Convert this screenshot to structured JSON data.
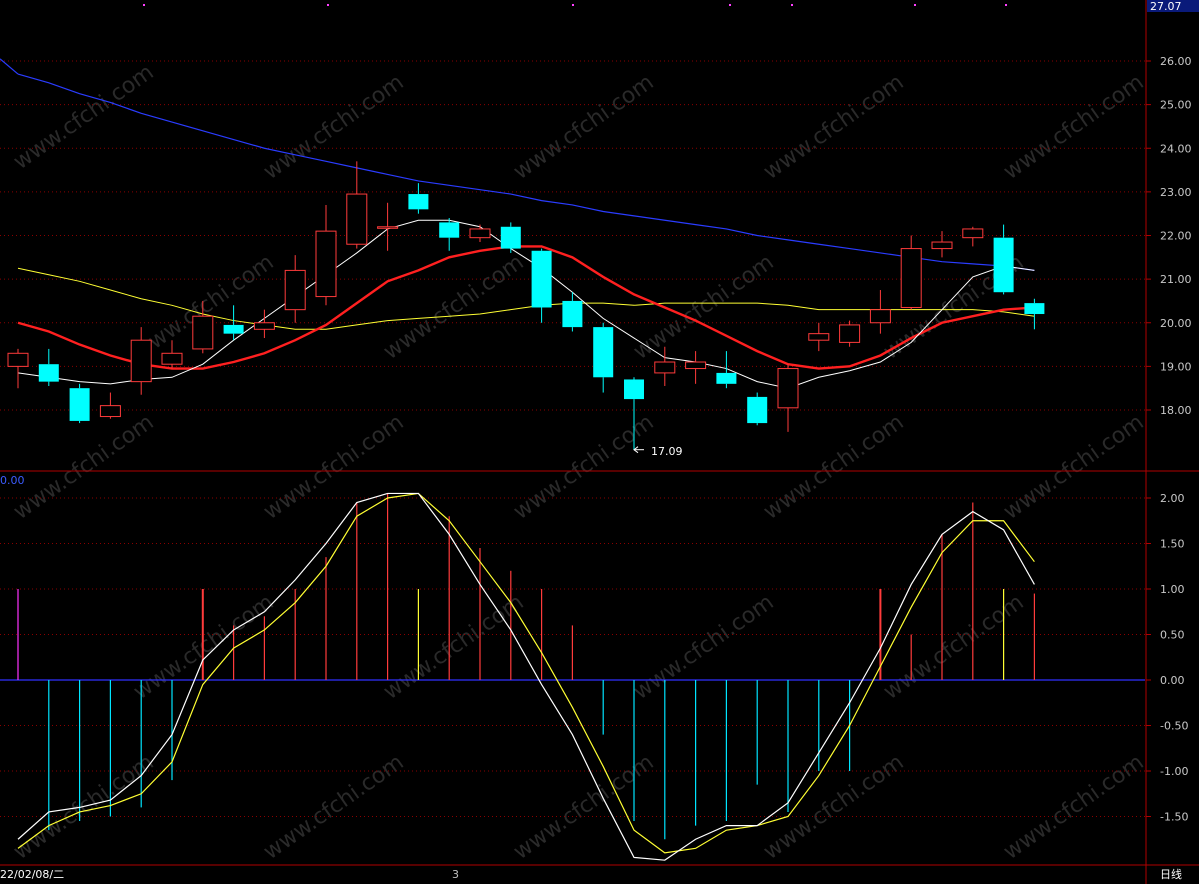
{
  "colors": {
    "background": "#000000",
    "grid": "#8a0000",
    "axis": "#b00000",
    "up": "#ff3b3b",
    "down": "#00ffff",
    "ma5": "#ffffff",
    "ma10": "#ff2020",
    "ma20": "#ffff33",
    "ma60": "#2a3cff",
    "macd_pos": "#ff3b3b",
    "macd_neg": "#00e5ff",
    "dif": "#ffffff",
    "dea": "#ffff33",
    "zero": "#3030ff"
  },
  "labels": {
    "price_top": "27.07",
    "low_marker": "17.09",
    "macd_top_left": "0.00",
    "date_label": "22/02/08/二",
    "axis_mark": "3",
    "period": "日线",
    "watermark": "www.cfchi.com"
  },
  "chart_data": [
    {
      "type": "candlestick",
      "title": "",
      "ylim": [
        16.6,
        27.3
      ],
      "y_ticks": [
        "18.00",
        "19.00",
        "20.00",
        "21.00",
        "22.00",
        "23.00",
        "24.00",
        "25.00",
        "26.00"
      ],
      "candles": [
        {
          "o": 19.0,
          "c": 19.3,
          "h": 19.4,
          "l": 18.5
        },
        {
          "o": 19.05,
          "c": 18.65,
          "h": 19.4,
          "l": 18.55
        },
        {
          "o": 18.5,
          "c": 17.75,
          "h": 18.6,
          "l": 17.7
        },
        {
          "o": 17.85,
          "c": 18.1,
          "h": 18.4,
          "l": 17.8
        },
        {
          "o": 18.65,
          "c": 19.6,
          "h": 19.9,
          "l": 18.35
        },
        {
          "o": 19.05,
          "c": 19.3,
          "h": 19.6,
          "l": 18.95
        },
        {
          "o": 19.4,
          "c": 20.15,
          "h": 20.5,
          "l": 19.3
        },
        {
          "o": 19.95,
          "c": 19.75,
          "h": 20.4,
          "l": 19.6
        },
        {
          "o": 19.85,
          "c": 20.0,
          "h": 20.3,
          "l": 19.65
        },
        {
          "o": 20.3,
          "c": 21.2,
          "h": 21.55,
          "l": 20.0
        },
        {
          "o": 20.6,
          "c": 22.1,
          "h": 22.7,
          "l": 20.4
        },
        {
          "o": 21.8,
          "c": 22.95,
          "h": 23.7,
          "l": 21.7
        },
        {
          "o": 22.2,
          "c": 22.2,
          "h": 22.75,
          "l": 21.65
        },
        {
          "o": 22.95,
          "c": 22.6,
          "h": 23.2,
          "l": 22.5
        },
        {
          "o": 22.3,
          "c": 21.95,
          "h": 22.4,
          "l": 21.65
        },
        {
          "o": 21.95,
          "c": 22.15,
          "h": 22.25,
          "l": 21.85
        },
        {
          "o": 22.2,
          "c": 21.7,
          "h": 22.3,
          "l": 21.6
        },
        {
          "o": 21.65,
          "c": 20.35,
          "h": 21.7,
          "l": 20.0
        },
        {
          "o": 20.5,
          "c": 19.9,
          "h": 20.7,
          "l": 19.8
        },
        {
          "o": 19.9,
          "c": 18.75,
          "h": 20.0,
          "l": 18.4
        },
        {
          "o": 18.7,
          "c": 18.25,
          "h": 18.75,
          "l": 17.09
        },
        {
          "o": 18.85,
          "c": 19.1,
          "h": 19.45,
          "l": 18.55
        },
        {
          "o": 18.95,
          "c": 19.1,
          "h": 19.35,
          "l": 18.6
        },
        {
          "o": 18.85,
          "c": 18.6,
          "h": 19.35,
          "l": 18.5
        },
        {
          "o": 18.3,
          "c": 17.7,
          "h": 18.4,
          "l": 17.65
        },
        {
          "o": 18.05,
          "c": 18.95,
          "h": 19.05,
          "l": 17.5
        },
        {
          "o": 19.6,
          "c": 19.75,
          "h": 20.0,
          "l": 19.35
        },
        {
          "o": 19.55,
          "c": 19.95,
          "h": 20.05,
          "l": 19.45
        },
        {
          "o": 20.0,
          "c": 20.3,
          "h": 20.75,
          "l": 19.75
        },
        {
          "o": 20.35,
          "c": 21.7,
          "h": 22.0,
          "l": 20.3
        },
        {
          "o": 21.7,
          "c": 21.85,
          "h": 22.1,
          "l": 21.5
        },
        {
          "o": 21.95,
          "c": 22.15,
          "h": 22.2,
          "l": 21.75
        },
        {
          "o": 21.95,
          "c": 20.7,
          "h": 22.25,
          "l": 20.65
        },
        {
          "o": 20.45,
          "c": 20.2,
          "h": 20.55,
          "l": 19.85
        }
      ],
      "ma5": [
        18.85,
        18.75,
        18.65,
        18.6,
        18.7,
        18.75,
        19.05,
        19.6,
        20.1,
        20.6,
        21.1,
        21.6,
        22.15,
        22.35,
        22.35,
        22.2,
        21.7,
        21.25,
        20.7,
        20.1,
        19.65,
        19.2,
        19.1,
        18.95,
        18.65,
        18.5,
        18.75,
        18.9,
        19.1,
        19.55,
        20.3,
        21.05,
        21.3,
        21.2
      ],
      "ma10": [
        20.0,
        19.8,
        19.5,
        19.25,
        19.05,
        18.95,
        18.95,
        19.1,
        19.3,
        19.6,
        19.95,
        20.45,
        20.95,
        21.2,
        21.5,
        21.65,
        21.75,
        21.75,
        21.5,
        21.05,
        20.65,
        20.35,
        20.05,
        19.7,
        19.35,
        19.05,
        18.95,
        19.0,
        19.25,
        19.65,
        20.0,
        20.15,
        20.3,
        20.35
      ],
      "ma20": [
        21.25,
        21.1,
        20.95,
        20.75,
        20.55,
        20.4,
        20.2,
        20.05,
        19.95,
        19.85,
        19.85,
        19.95,
        20.05,
        20.1,
        20.15,
        20.2,
        20.3,
        20.4,
        20.45,
        20.45,
        20.4,
        20.45,
        20.45,
        20.45,
        20.45,
        20.4,
        20.3,
        20.3,
        20.3,
        20.3,
        20.3,
        20.3,
        20.25,
        20.15
      ],
      "ma60": [
        25.7,
        25.5,
        25.25,
        25.05,
        24.8,
        24.6,
        24.4,
        24.2,
        24.0,
        23.85,
        23.7,
        23.55,
        23.4,
        23.25,
        23.15,
        23.05,
        22.95,
        22.8,
        22.7,
        22.55,
        22.45,
        22.35,
        22.25,
        22.15,
        22.0,
        21.9,
        21.8,
        21.7,
        21.6,
        21.5,
        21.4,
        21.35,
        21.3,
        21.2
      ]
    },
    {
      "type": "bar",
      "title": "",
      "ylim": [
        -2.0,
        2.1
      ],
      "y_ticks": [
        "2.00",
        "1.50",
        "1.00",
        "0.50",
        "0.00",
        "-0.50",
        "-1.00",
        "-1.50"
      ],
      "macd": [
        1.0,
        -1.65,
        -1.55,
        -1.5,
        -1.4,
        -1.1,
        1.0,
        0.6,
        0.7,
        1.0,
        1.35,
        1.95,
        2.05,
        1.0,
        1.8,
        1.45,
        1.2,
        1.0,
        0.6,
        -0.6,
        -1.55,
        -1.75,
        -1.6,
        -1.55,
        -1.15,
        -1.45,
        -1.0,
        -1.0,
        1.0,
        0.5,
        1.6,
        1.95,
        1.0,
        0.95
      ],
      "macd_highlight": [
        0,
        0,
        0,
        0,
        0,
        0,
        0,
        0,
        0,
        0,
        0,
        0,
        0,
        1,
        0,
        0,
        0,
        0,
        0,
        0,
        0,
        0,
        2,
        0,
        0,
        0,
        0,
        0,
        0,
        0,
        0,
        0,
        1,
        0
      ],
      "dif": [
        -1.75,
        -1.45,
        -1.4,
        -1.32,
        -1.05,
        -0.6,
        0.22,
        0.55,
        0.75,
        1.1,
        1.5,
        1.95,
        2.05,
        2.05,
        1.6,
        1.05,
        0.55,
        -0.05,
        -0.6,
        -1.3,
        -1.95,
        -1.98,
        -1.75,
        -1.6,
        -1.6,
        -1.35,
        -0.8,
        -0.25,
        0.35,
        1.05,
        1.6,
        1.85,
        1.65,
        1.05
      ],
      "dea": [
        -1.85,
        -1.6,
        -1.45,
        -1.38,
        -1.25,
        -0.9,
        -0.05,
        0.35,
        0.55,
        0.85,
        1.25,
        1.8,
        2.0,
        2.05,
        1.75,
        1.3,
        0.85,
        0.3,
        -0.3,
        -0.95,
        -1.65,
        -1.9,
        -1.85,
        -1.65,
        -1.6,
        -1.5,
        -1.05,
        -0.5,
        0.15,
        0.8,
        1.4,
        1.75,
        1.75,
        1.3
      ]
    }
  ]
}
